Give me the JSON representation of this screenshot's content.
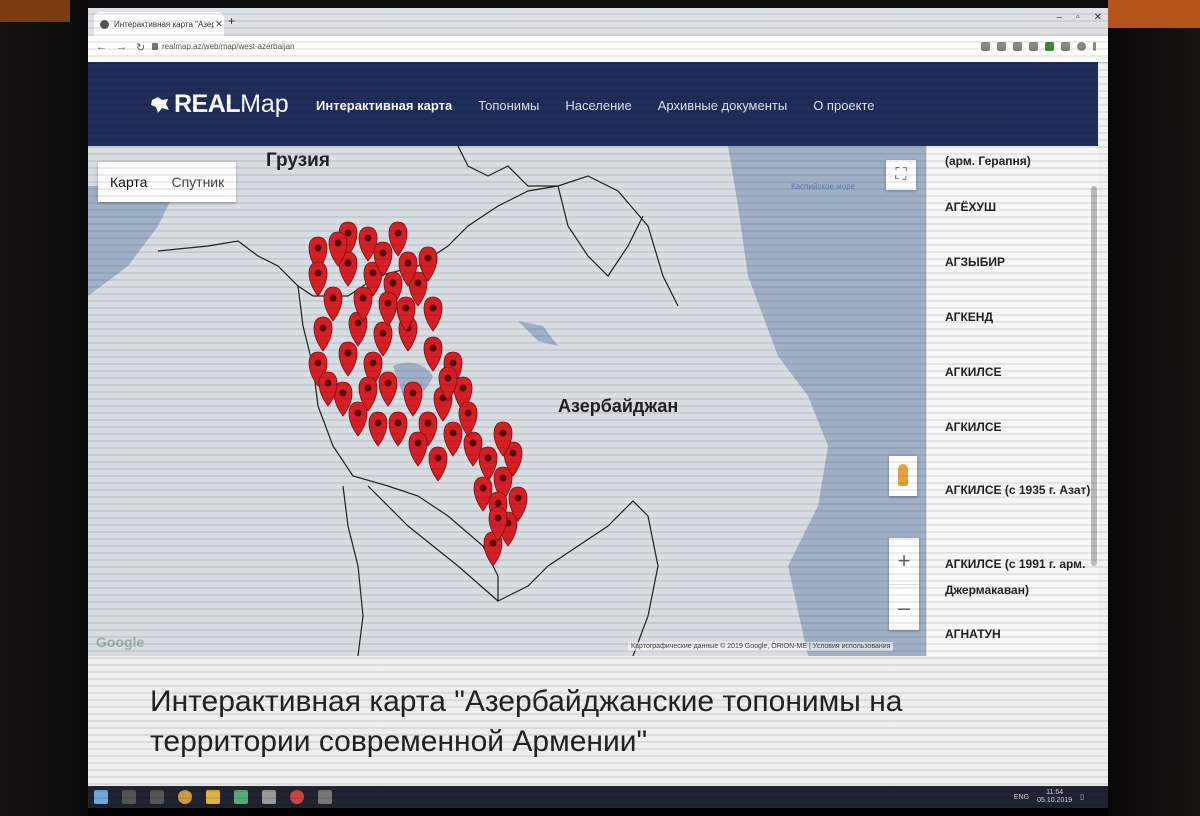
{
  "browser": {
    "tab_title": "Интерактивная карта \"Азербай...",
    "url": "realmap.az/web/map/west-azerbaijan",
    "window_controls": [
      "–",
      "▫",
      "✕"
    ]
  },
  "site": {
    "logo": {
      "bold": "REAL",
      "light": "Map"
    },
    "nav": [
      {
        "label": "Интерактивная карта",
        "active": true
      },
      {
        "label": "Топонимы",
        "active": false
      },
      {
        "label": "Население",
        "active": false
      },
      {
        "label": "Архивные документы",
        "active": false
      },
      {
        "label": "О проекте",
        "active": false
      }
    ]
  },
  "map": {
    "type_buttons": [
      "Карта",
      "Спутник"
    ],
    "labels": {
      "georgia": "Грузия",
      "azerbaijan": "Азербайджан",
      "caspian": "Каспийское море"
    },
    "attribution": "Картографические данные © 2019 Google, ORION-ME | Условия использования",
    "google": "Google",
    "zoom_in": "+",
    "zoom_out": "–",
    "fullscreen": "⛶",
    "marker_color": "#d91f26"
  },
  "sidebar": {
    "items": [
      "(арм. Герапня)",
      "АГЁХУШ",
      "АГЗЫБИР",
      "АГКЕНД",
      "АГКИЛСЕ",
      "АГКИЛСЕ",
      "АГКИЛСЕ (с 1935 г. Азат)",
      "АГКИЛСЕ (с 1991 г. арм. Джермакаван)",
      "АГНАТУН"
    ]
  },
  "page": {
    "title": "Интерактивная карта \"Азербайджанские топонимы на территории современной Армении\""
  },
  "taskbar": {
    "tray": "ENG",
    "time": "11:54",
    "date": "05.10.2019"
  },
  "colors": {
    "header": "#1f2d59",
    "marker": "#d91f26"
  }
}
